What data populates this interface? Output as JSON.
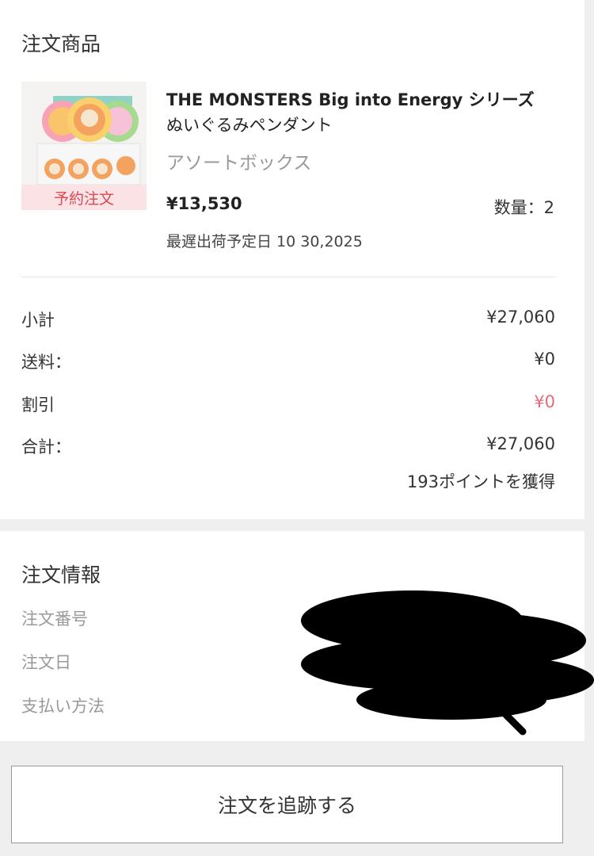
{
  "items_section": {
    "title": "注文商品",
    "product": {
      "name_line1": "THE MONSTERS Big into Energy シリーズ",
      "name_line2": "ぬいぐるみペンダント",
      "variant": "アソートボックス",
      "badge": "予約注文",
      "image_icon": "product-box-image",
      "price": "¥13,530",
      "quantity": "数量：2",
      "shipping_date": "最遅出荷予定日 10 30,2025"
    },
    "summary": {
      "subtotal_label": "小計",
      "subtotal_value": "¥27,060",
      "shipping_label": "送料：",
      "shipping_value": "¥0",
      "discount_label": "割引",
      "discount_value": "¥0",
      "total_label": "合計：",
      "total_value": "¥27,060",
      "points": "193ポイントを獲得"
    }
  },
  "info_section": {
    "title": "注文情報",
    "order_number_label": "注文番号",
    "order_date_label": "注文日",
    "payment_method_label": "支払い方法"
  },
  "actions": {
    "track_order": "注文を追跡する"
  },
  "colors": {
    "accent_red": "#e46b78",
    "badge_bg": "#fbe3e5",
    "page_bg": "#efefef"
  }
}
